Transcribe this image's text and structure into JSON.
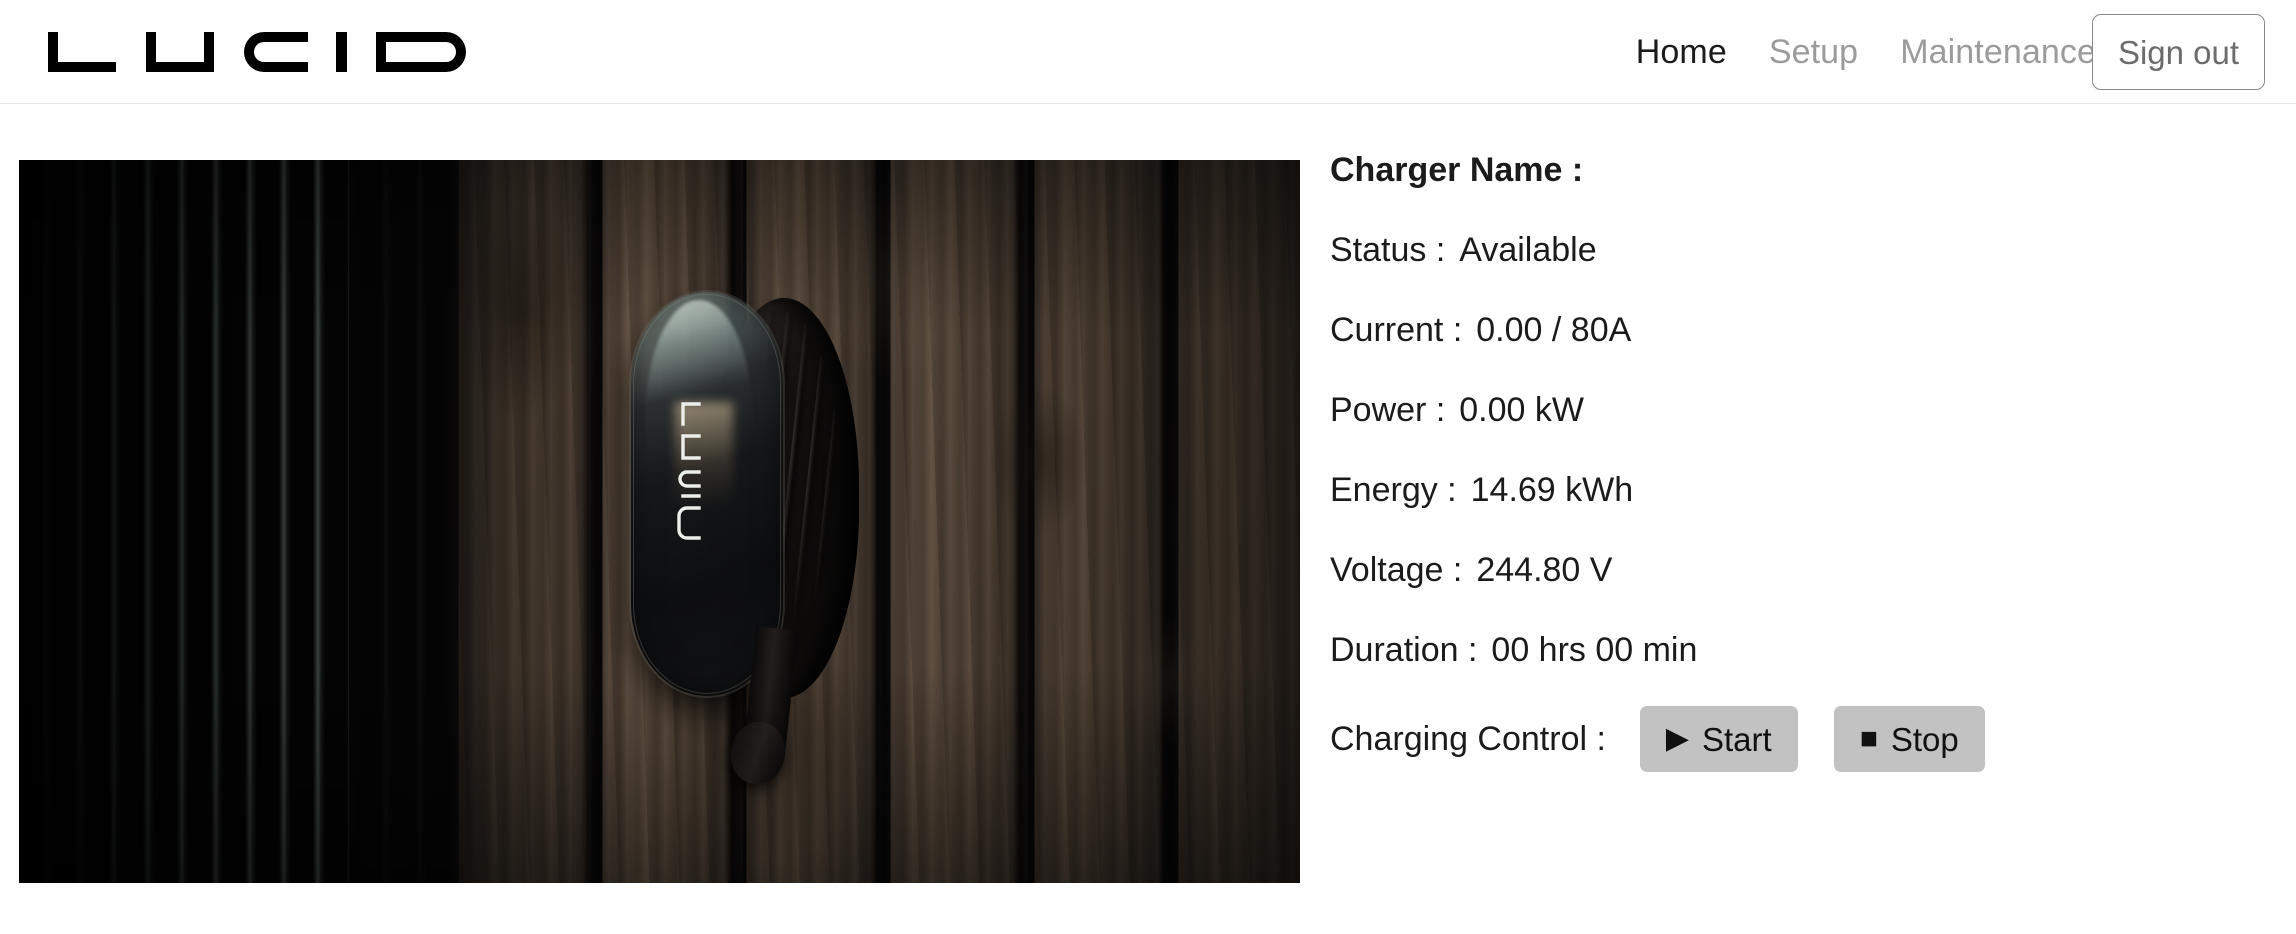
{
  "header": {
    "logo_text": "LUCID",
    "logo_icon": "lucid-wordmark",
    "nav": [
      {
        "label": "Home",
        "active": true
      },
      {
        "label": "Setup",
        "active": false
      },
      {
        "label": "Maintenance",
        "active": false
      }
    ],
    "signout_label": "Sign out"
  },
  "photo": {
    "alt": "Lucid Connected Home Charging Station mounted on a wood plank wall",
    "unit_logo_text": "LUCID"
  },
  "info": {
    "rows": [
      {
        "label": "Charger Name :",
        "value": "",
        "bold": true
      },
      {
        "label": "Status :",
        "value": "Available",
        "bold": false
      },
      {
        "label": "Current :",
        "value": "0.00 / 80A",
        "bold": false
      },
      {
        "label": "Power :",
        "value": "0.00 kW",
        "bold": false
      },
      {
        "label": "Energy :",
        "value": "14.69 kWh",
        "bold": false
      },
      {
        "label": "Voltage :",
        "value": "244.80 V",
        "bold": false
      },
      {
        "label": "Duration :",
        "value": "00 hrs 00 min",
        "bold": false
      }
    ],
    "control_label": "Charging Control :",
    "start_label": "Start",
    "start_glyph": "▶",
    "stop_label": "Stop",
    "stop_glyph": "■"
  },
  "colors": {
    "text": "#1b1b1b",
    "muted": "#9b9b9b",
    "button_gray": "#c2c2c2",
    "border": "#e8e8e8",
    "signout_border": "#8a8a8a"
  }
}
